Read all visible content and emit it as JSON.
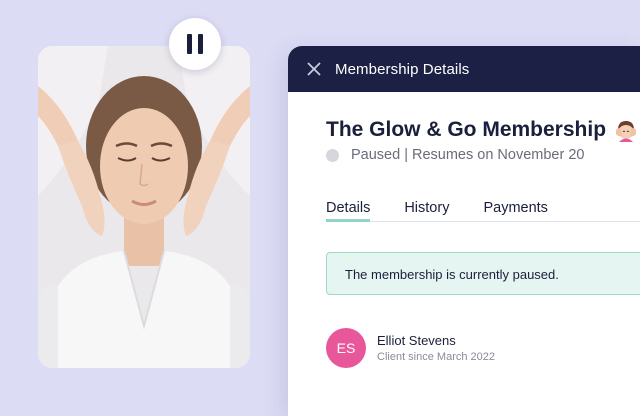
{
  "media": {
    "pause_icon": "pause-icon"
  },
  "panel": {
    "title": "Membership Details",
    "close_icon": "close-icon",
    "membership_name": "The Glow & Go Membership",
    "membership_emoji": "woman-getting-massage-emoji",
    "status": {
      "text": "Paused | Resumes on November 20",
      "dot_color": "#d6d6dc"
    },
    "tabs": [
      {
        "label": "Details",
        "active": true
      },
      {
        "label": "History",
        "active": false
      },
      {
        "label": "Payments",
        "active": false
      }
    ],
    "alert_text": "The membership is currently paused.",
    "client": {
      "initials": "ES",
      "name": "Elliot Stevens",
      "since": "Client since March 2022"
    }
  },
  "colors": {
    "background": "#dcdcf5",
    "header": "#1d2045",
    "accent_teal": "#8fd4c8",
    "alert_bg": "#e5f5f1",
    "avatar": "#e8579a"
  }
}
